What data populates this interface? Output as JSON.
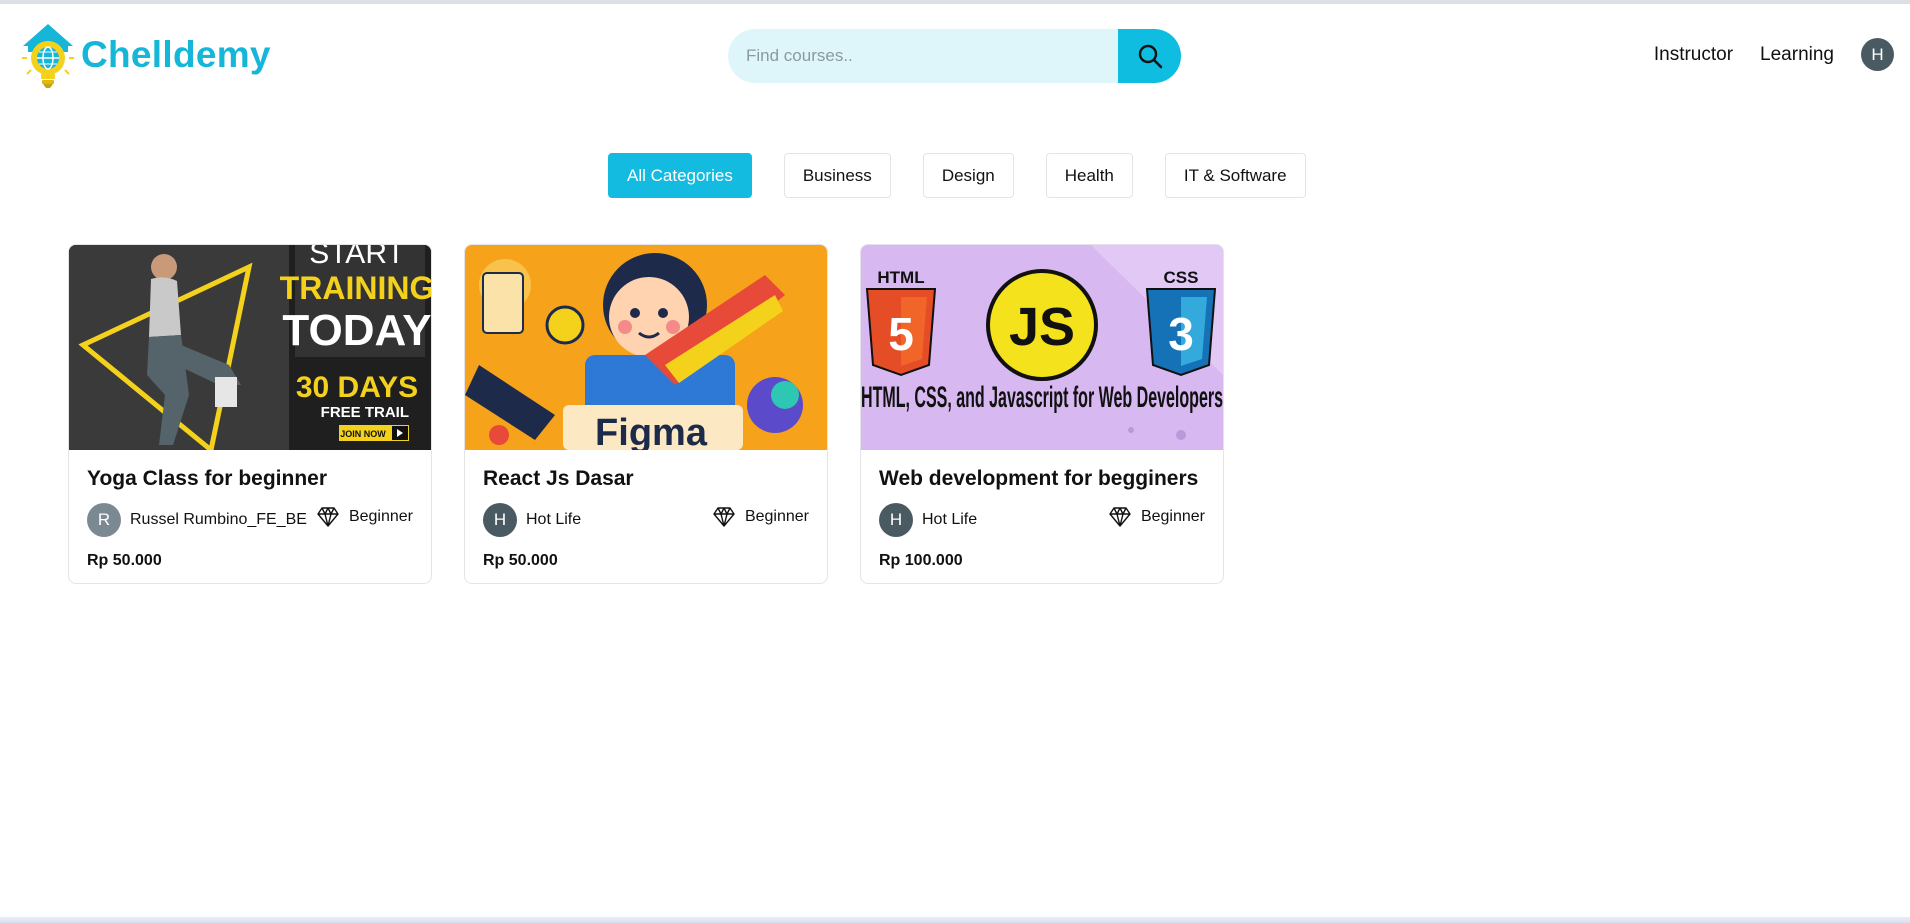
{
  "brand": {
    "name": "Chelldemy",
    "accent": "#16b6d8"
  },
  "search": {
    "placeholder": "Find courses..",
    "value": "",
    "icon": "search-icon"
  },
  "nav": {
    "instructor_label": "Instructor",
    "learning_label": "Learning",
    "avatar_initial": "H"
  },
  "categories": [
    {
      "label": "All Categories",
      "active": true
    },
    {
      "label": "Business",
      "active": false
    },
    {
      "label": "Design",
      "active": false
    },
    {
      "label": "Health",
      "active": false
    },
    {
      "label": "IT & Software",
      "active": false
    }
  ],
  "courses": [
    {
      "title": "Yoga Class for beginner",
      "author": "Russel Rumbino_FE_BE",
      "author_initial": "R",
      "avatar_color": "#7b8a92",
      "level": "Beginner",
      "price": "Rp 50.000",
      "thumb": {
        "line1": "START",
        "line2": "TRAINING",
        "line3": "TODAY",
        "line4": "30 DAYS",
        "line5": "FREE TRAIL",
        "cta": "JOIN NOW"
      }
    },
    {
      "title": "React Js Dasar",
      "author": "Hot Life",
      "author_initial": "H",
      "avatar_color": "#4a5a63",
      "level": "Beginner",
      "price": "Rp 50.000",
      "thumb": {
        "caption": "Figma"
      }
    },
    {
      "title": "Web development for begginers",
      "author": "Hot Life",
      "author_initial": "H",
      "avatar_color": "#4a5a63",
      "level": "Beginner",
      "price": "Rp 100.000",
      "thumb": {
        "badge_left": "HTML",
        "badge_center": "JS",
        "badge_right": "CSS",
        "caption": "HTML, CSS, and Javascript for Web Developers"
      }
    }
  ]
}
